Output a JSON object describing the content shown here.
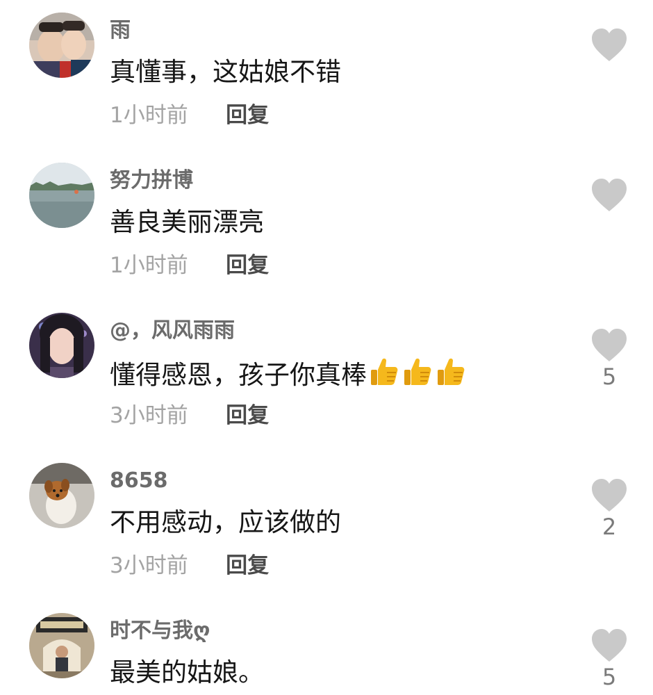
{
  "comments": [
    {
      "username": "雨",
      "text": "真懂事，这姑娘不错",
      "emoji": [],
      "time": "1小时前",
      "reply_label": "回复",
      "like_count": "",
      "avatar": "two-children-photo"
    },
    {
      "username": "努力拼博",
      "text": "善良美丽漂亮",
      "emoji": [],
      "time": "1小时前",
      "reply_label": "回复",
      "like_count": "",
      "avatar": "lake-landscape-photo"
    },
    {
      "username": "@，风风雨雨",
      "text": "懂得感恩，孩子你真棒",
      "emoji": [
        "thumbs-up",
        "thumbs-up",
        "thumbs-up"
      ],
      "time": "3小时前",
      "reply_label": "回复",
      "like_count": "5",
      "avatar": "woman-portrait-photo"
    },
    {
      "username": "8658",
      "text": "不用感动，应该做的",
      "emoji": [],
      "time": "3小时前",
      "reply_label": "回复",
      "like_count": "2",
      "avatar": "dog-photo"
    },
    {
      "username": "时不与我ღ",
      "text": "最美的姑娘。",
      "emoji": [],
      "time": "",
      "reply_label": "",
      "like_count": "5",
      "avatar": "person-at-gate-photo"
    }
  ],
  "colors": {
    "heart": "#c9c9c9",
    "username": "#6b6b6b",
    "text": "#161616",
    "time": "#a3a3a3",
    "reply": "#4a4a4a"
  }
}
